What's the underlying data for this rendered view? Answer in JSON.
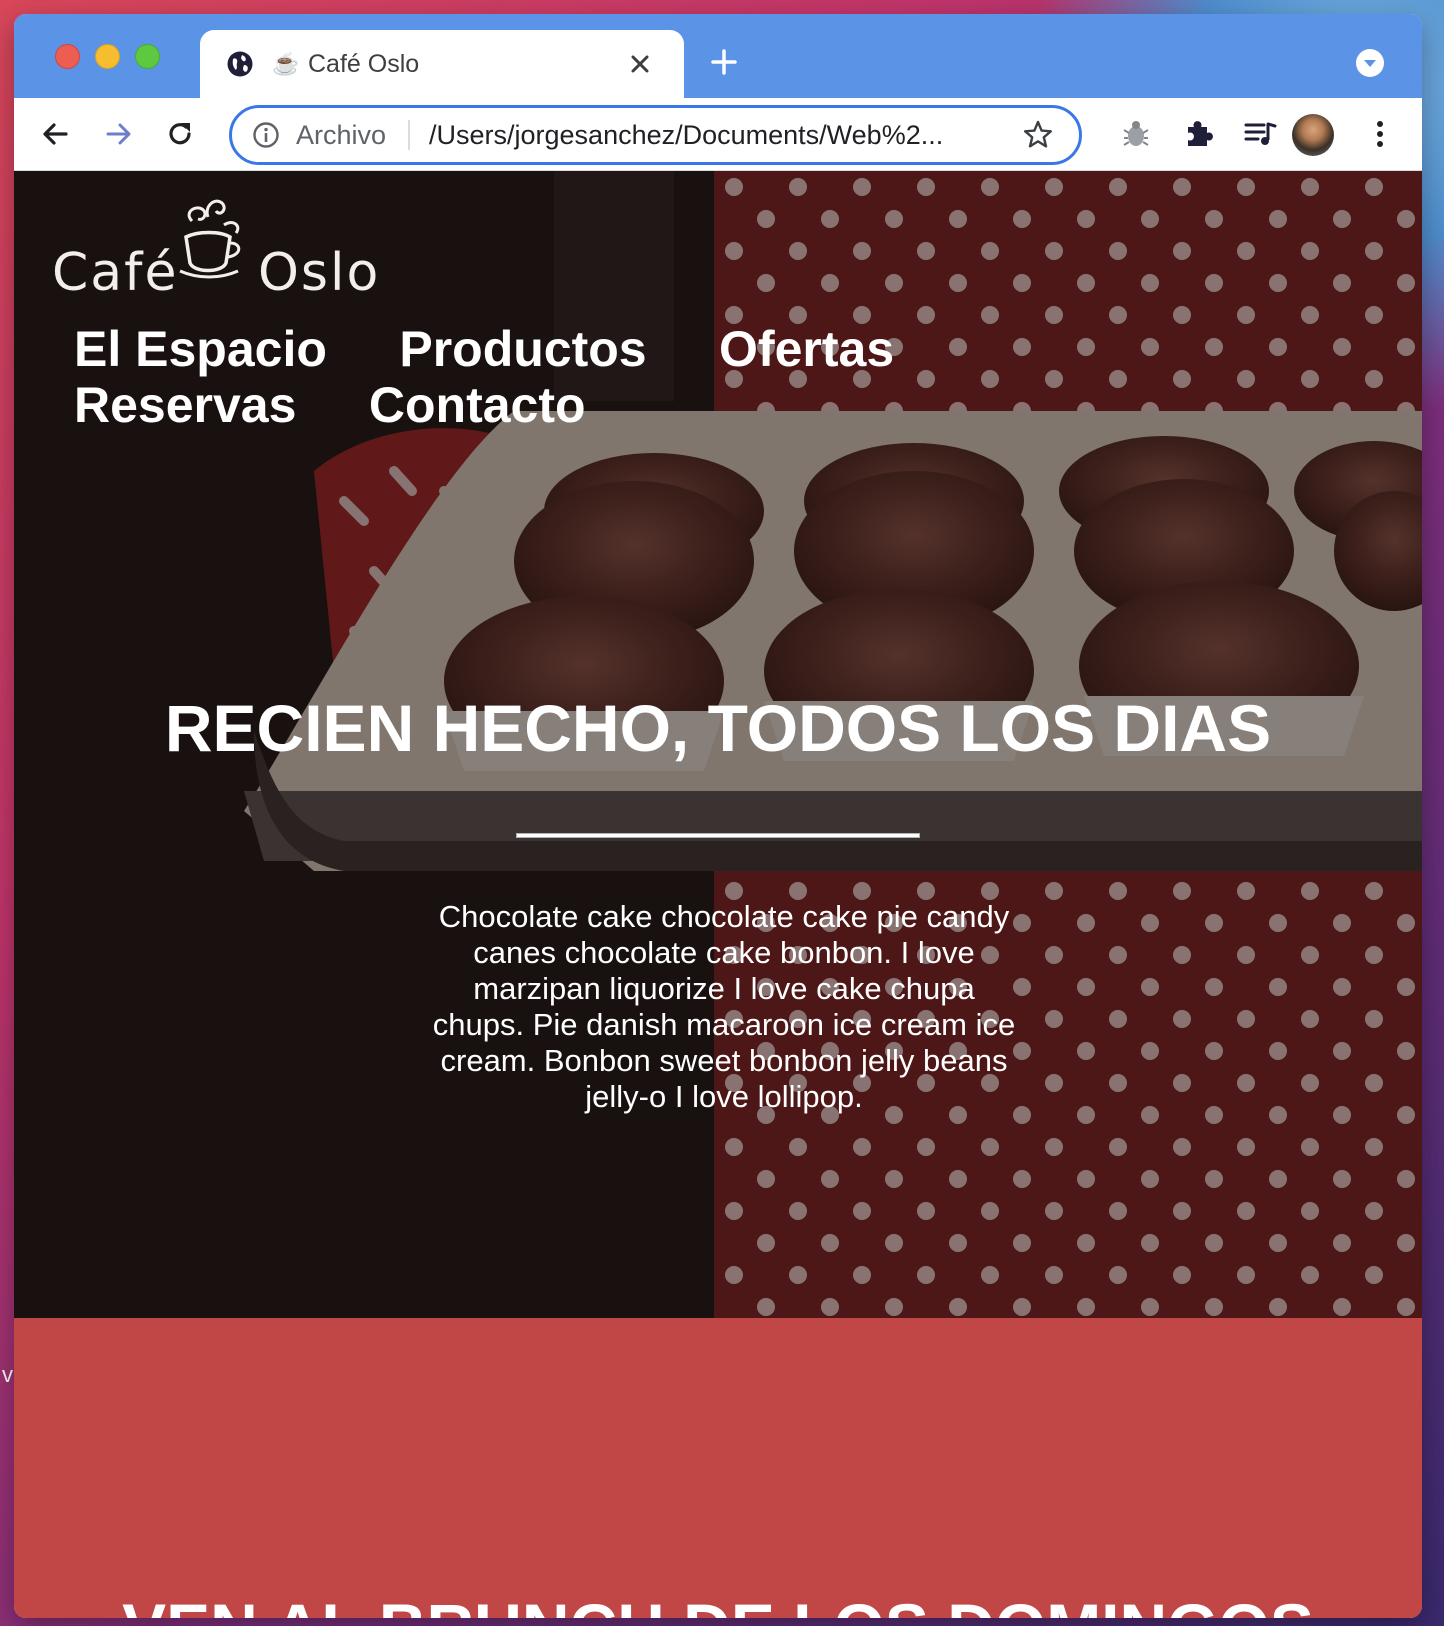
{
  "browser": {
    "tab_title": "Café Oslo",
    "address_scheme_label": "Archivo",
    "address_url": "/Users/jorgesanchez/Documents/Web%2...",
    "accent_color": "#5b93e6"
  },
  "desktop": {
    "edge_text": "v"
  },
  "site": {
    "logo": {
      "word_left": "Café",
      "word_right": "Oslo"
    },
    "nav": [
      "El Espacio",
      "Productos",
      "Ofertas",
      "Reservas",
      "Contacto"
    ],
    "hero": {
      "title": "RECIEN HECHO, TODOS LOS DIAS",
      "text": "Chocolate cake chocolate cake pie candy canes chocolate cake bonbon. I love marzipan liquorize I love cake chupa chups. Pie danish macaroon ice cream ice cream. Bonbon sweet bonbon jelly beans jelly-o I love lollipop."
    },
    "brunch": {
      "title": "VEN AL BRUNCH DE LOS DOMINGOS",
      "background": "#c14646"
    }
  }
}
